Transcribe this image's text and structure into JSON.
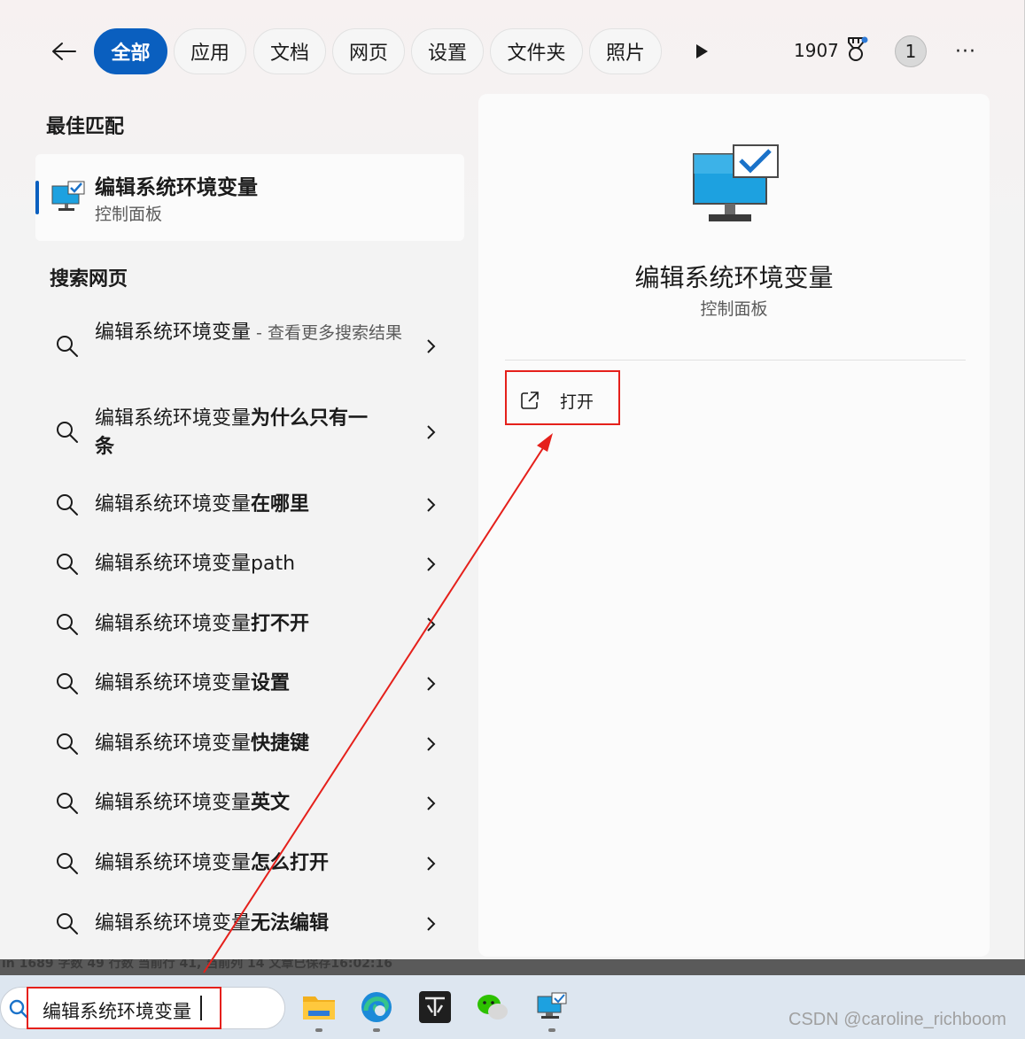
{
  "filter_tabs": [
    "全部",
    "应用",
    "文档",
    "网页",
    "设置",
    "文件夹",
    "照片"
  ],
  "active_tab_index": 0,
  "header": {
    "points": "1907",
    "avatar_initial": "1",
    "more": "···"
  },
  "best_match": {
    "section_title": "最佳匹配",
    "title": "编辑系统环境变量",
    "subtitle": "控制面板"
  },
  "web_search": {
    "section_title": "搜索网页",
    "items": [
      {
        "base": "编辑系统环境变量",
        "bold": "",
        "suffix": " - 查看更多搜索结果"
      },
      {
        "base": "编辑系统环境变量",
        "bold": "为什么只有一条",
        "suffix": ""
      },
      {
        "base": "编辑系统环境变量",
        "bold": "在哪里",
        "suffix": ""
      },
      {
        "base": "编辑系统环境变量",
        "bold": "path",
        "suffix": ""
      },
      {
        "base": "编辑系统环境变量",
        "bold": "打不开",
        "suffix": ""
      },
      {
        "base": "编辑系统环境变量",
        "bold": "设置",
        "suffix": ""
      },
      {
        "base": "编辑系统环境变量",
        "bold": "快捷键",
        "suffix": ""
      },
      {
        "base": "编辑系统环境变量",
        "bold": "英文",
        "suffix": ""
      },
      {
        "base": "编辑系统环境变量",
        "bold": "怎么打开",
        "suffix": ""
      },
      {
        "base": "编辑系统环境变量",
        "bold": "无法编辑",
        "suffix": ""
      }
    ]
  },
  "preview": {
    "title": "编辑系统环境变量",
    "subtitle": "控制面板",
    "open_label": "打开"
  },
  "background_status": "ın  1689 字数  49 行数  当前行 41, 当前列 14  文章已保存16:02:16",
  "taskbar": {
    "search_value": "编辑系统环境变量",
    "apps": [
      "file-explorer-icon",
      "edge-icon",
      "jetbrains-icon",
      "wechat-icon",
      "system-properties-icon"
    ]
  },
  "watermark": "CSDN @caroline_richboom",
  "colors": {
    "accent": "#0a5fbf",
    "annotation": "#e5201b"
  }
}
